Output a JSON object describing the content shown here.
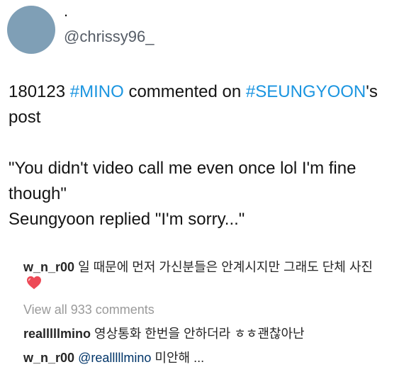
{
  "profile": {
    "display_name": ".",
    "handle": "@chrissy96_"
  },
  "tweet": {
    "date": "180123",
    "hashtag_1": "#MINO",
    "middle_text": "commented on",
    "hashtag_2": "#SEUNGYOON",
    "suffix": "'s post",
    "quote": "\"You didn't video call me even once lol I'm fine though\"",
    "reply_line": "Seungyoon replied \"I'm sorry...\""
  },
  "comments": {
    "first": {
      "user": "w_n_r00",
      "text": "일 때문에 먼저 가신분들은 안계시지만 그래도 단체 사진"
    },
    "view_all": "View all 933 comments",
    "second": {
      "user": "realllllmino",
      "text": "영상통화 한번을 안하더라 ㅎㅎ괜찮아난"
    },
    "third": {
      "user": "w_n_r00",
      "mention": "@realllllmino",
      "text": "미안해 ..."
    }
  },
  "colors": {
    "hashtag": "#1b95e0",
    "avatar": "#7f9fb6",
    "heart": "#ed4956",
    "muted": "#9a9a9a"
  },
  "icons": {
    "heart": "heart-emoji-icon"
  }
}
